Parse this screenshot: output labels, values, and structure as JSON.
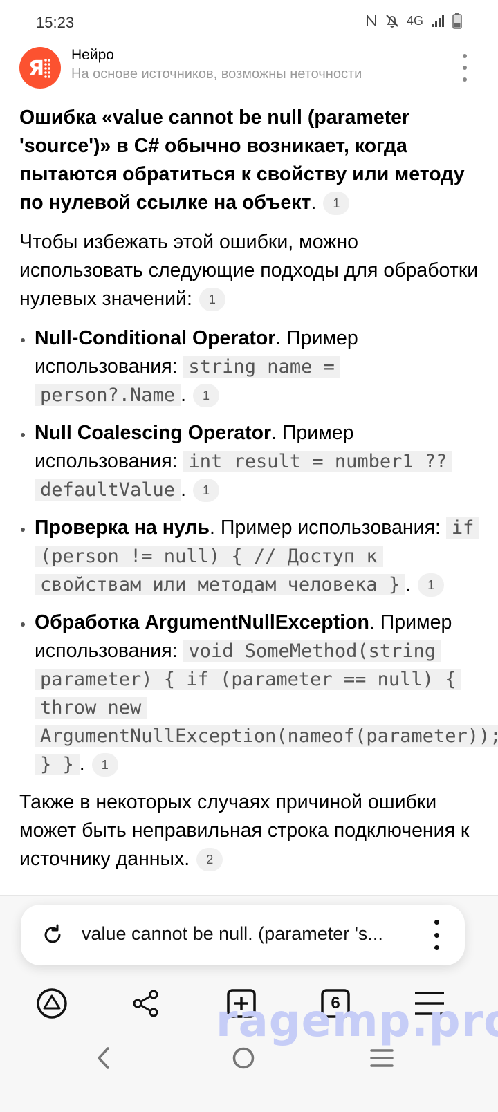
{
  "status": {
    "time": "15:23",
    "network": "4G"
  },
  "header": {
    "title": "Нейро",
    "subtitle": "На основе источников, возможны неточности"
  },
  "answer": {
    "intro_bold": "Ошибка «value cannot be null (parameter 'source')» в C# обычно возникает, когда пытаются обратиться к свойству или методу по нулевой ссылке на объект",
    "intro_end": ".",
    "intro_cite": "1",
    "p2": "Чтобы избежать этой ошибки, можно использовать следующие подходы для обработки нулевых значений:",
    "p2_cite": "1",
    "items": [
      {
        "title": "Null-Conditional Operator",
        "text": ". Пример использования: ",
        "code": "string name = person?.Name",
        "end": ".",
        "cite": "1"
      },
      {
        "title": "Null Coalescing Operator",
        "text": ". Пример использования: ",
        "code": "int result = number1 ?? defaultValue",
        "end": ".",
        "cite": "1"
      },
      {
        "title": "Проверка на нуль",
        "text": ". Пример использования: ",
        "code": "if (person != null) { // Доступ к свойствам или методам человека }",
        "end": ".",
        "cite": "1"
      },
      {
        "title": "Обработка ArgumentNullException",
        "text": ". Пример использования: ",
        "code": "void SomeMethod(string parameter) { if (parameter == null) { throw new ArgumentNullException(nameof(parameter)); } }",
        "end": ".",
        "cite": "1"
      }
    ],
    "p3": "Также в некоторых случаях причиной ошибки может быть неправильная строка подключения к источнику данных.",
    "p3_cite": "2"
  },
  "search_bar": {
    "query": "value cannot be null. (parameter 's..."
  },
  "toolbar": {
    "tabs_count": "6"
  },
  "watermark": "ragemp.pro",
  "icons": {
    "nfc": "nfc-icon",
    "mute": "bell-off-icon",
    "signal": "signal-icon",
    "battery": "battery-icon",
    "logo": "yandex-neuro-logo",
    "menu": "kebab-menu-icon",
    "refresh": "refresh-icon",
    "alice": "alice-icon",
    "share": "share-icon",
    "new_tab": "new-tab-icon",
    "tabs": "tabs-icon",
    "hamburger": "hamburger-menu-icon",
    "back": "back-nav-icon",
    "home": "home-nav-icon",
    "recents": "recents-nav-icon"
  },
  "colors": {
    "logo": "#fc5230",
    "watermark": "#c6cdf7",
    "code_bg": "#f0f0f0"
  }
}
